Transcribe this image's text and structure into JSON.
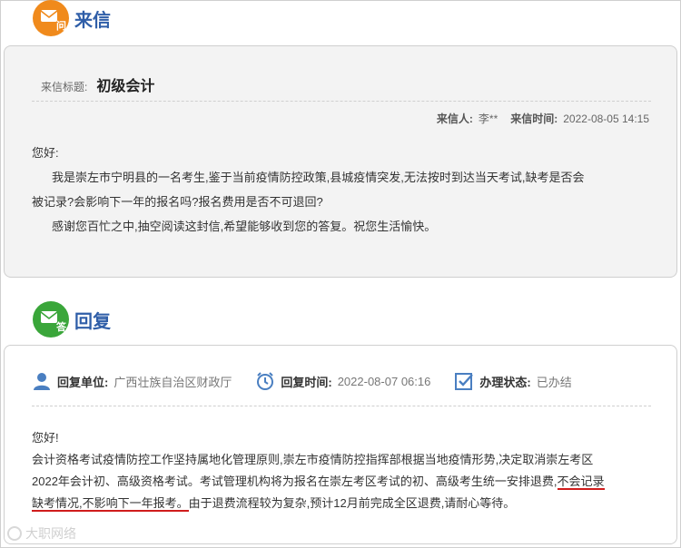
{
  "letter_section": {
    "title": "来信",
    "badge_char": "问",
    "subject_label": "来信标题:",
    "subject": "初级会计",
    "sender_label": "来信人:",
    "sender": "李**",
    "time_label": "来信时间:",
    "time": "2022-08-05 14:15",
    "greeting": "您好:",
    "para1_line1": "我是崇左市宁明县的一名考生,鉴于当前疫情防控政策,县城疫情突发,无法按时到达当天考试,缺考是否会",
    "para1_line2": "被记录?会影响下一年的报名吗?报名费用是否不可退回?",
    "para2": "感谢您百忙之中,抽空阅读这封信,希望能够收到您的答复。祝您生活愉快。"
  },
  "reply_section": {
    "title": "回复",
    "badge_char": "答",
    "unit_label": "回复单位:",
    "unit": "广西壮族自治区财政厅",
    "time_label": "回复时间:",
    "time": "2022-08-07 06:16",
    "status_label": "办理状态:",
    "status": "已办结",
    "greeting": "您好!",
    "body_line1": "会计资格考试疫情防控工作坚持属地化管理原则,崇左市疫情防控指挥部根据当地疫情形势,决定取消崇左考区",
    "body_line2_a": "2022年会计初、高级资格考试。考试管理机构将为报名在崇左考区考试的初、高级考生统一安排退费,",
    "body_line2_b": "不会记录",
    "body_line3_a": "缺考情况,不影响下一年报考。",
    "body_line3_b": "由于退费流程较为复杂,预计12月前完成全区退费,请耐心等待。"
  },
  "watermark": "大职网络",
  "colors": {
    "accent_blue": "#2f5ea8",
    "orange_badge": "#f08a1c",
    "green_badge": "#3aa63a",
    "underline_red": "#d01c1c",
    "icon_blue": "#4a7fc1"
  },
  "icons": [
    "envelope-question-icon",
    "envelope-answer-icon",
    "user-icon",
    "clock-icon",
    "check-box-icon"
  ]
}
